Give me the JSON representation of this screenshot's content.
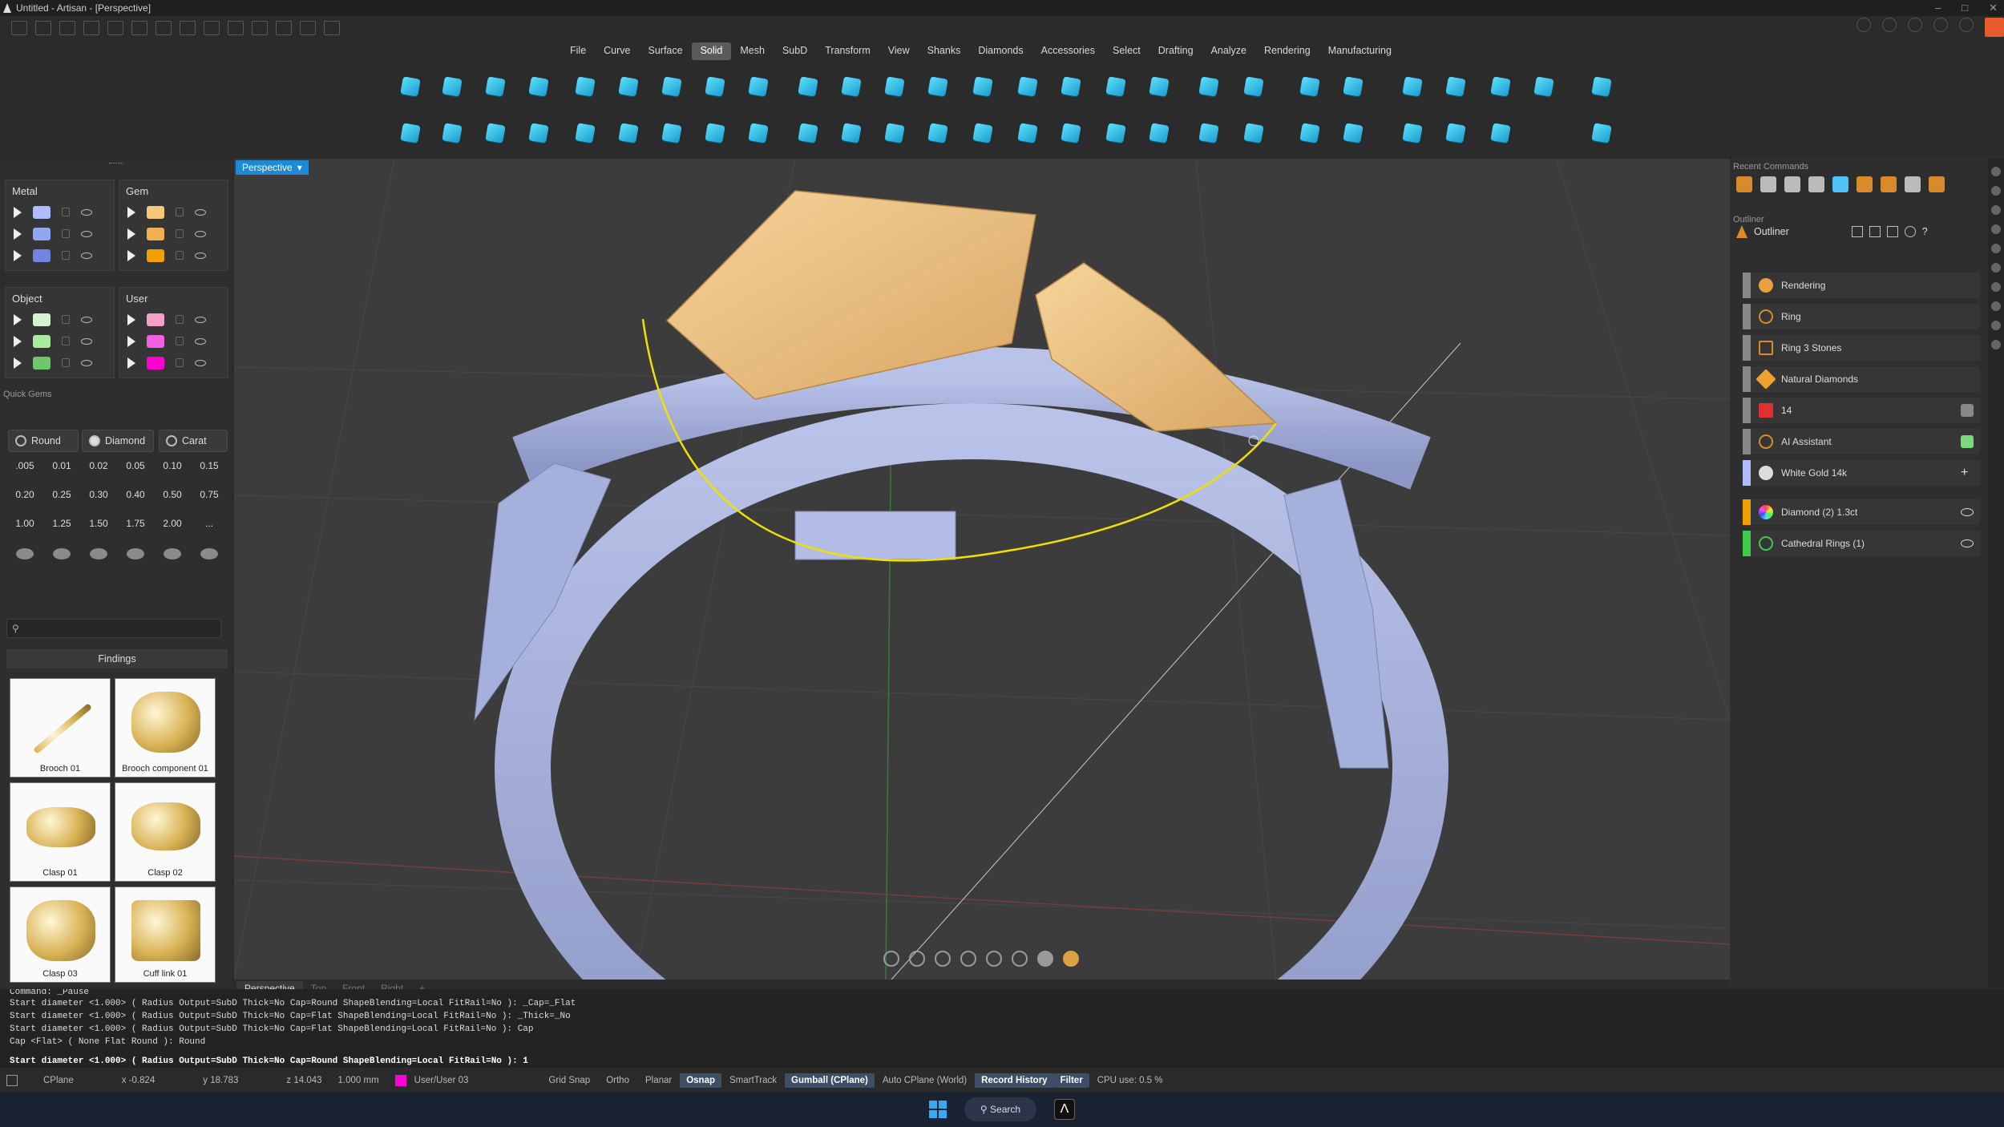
{
  "window": {
    "title": "Untitled - Artisan - [Perspective]"
  },
  "menus": [
    "File",
    "Curve",
    "Surface",
    "Solid",
    "Mesh",
    "SubD",
    "Transform",
    "View",
    "Shanks",
    "Diamonds",
    "Accessories",
    "Select",
    "Drafting",
    "Analyze",
    "Rendering",
    "Manufacturing"
  ],
  "menu_active": "Solid",
  "layers": {
    "metal": {
      "title": "Metal",
      "colors": [
        "#aebcff",
        "#8ea8f0",
        "#6f86e0"
      ]
    },
    "gem": {
      "title": "Gem",
      "colors": [
        "#f5c87a",
        "#f0b04e",
        "#f0a000"
      ]
    },
    "object": {
      "title": "Object",
      "colors": [
        "#d4f5d0",
        "#a8ec9e",
        "#6ec86a"
      ]
    },
    "user": {
      "title": "User",
      "colors": [
        "#f5a0c8",
        "#f060e0",
        "#ff00d0"
      ]
    }
  },
  "quick_gems": {
    "label": "Quick Gems",
    "tabs": [
      "Round",
      "Diamond",
      "Carat"
    ],
    "sizes": [
      ".005",
      "0.01",
      "0.02",
      "0.05",
      "0.10",
      "0.15",
      "0.20",
      "0.25",
      "0.30",
      "0.40",
      "0.50",
      "0.75",
      "1.00",
      "1.25",
      "1.50",
      "1.75",
      "2.00",
      "..."
    ]
  },
  "library": {
    "search_placeholder": "",
    "group": "Findings",
    "items": [
      "Brooch 01",
      "Brooch component 01",
      "Clasp 01",
      "Clasp 02",
      "Clasp 03",
      "Cuff link 01"
    ]
  },
  "viewport": {
    "active_tab": "Perspective",
    "tabs": [
      "Perspective",
      "Top",
      "Front",
      "Right"
    ],
    "add_tab": "+"
  },
  "recent_commands": {
    "label": "Recent Commands"
  },
  "outliner": {
    "label": "Outliner",
    "title": "Outliner",
    "rows": [
      {
        "label": "Rendering",
        "color": "#888888",
        "icon_color": "#e8a040"
      },
      {
        "label": "Ring",
        "color": "#888888",
        "icon_color": "#d98a2b"
      },
      {
        "label": "Ring 3 Stones",
        "color": "#888888",
        "icon_color": "#d98a2b"
      },
      {
        "label": "Natural Diamonds",
        "color": "#888888",
        "icon_color": "#f0a030"
      },
      {
        "label": "14",
        "color": "#888888",
        "icon_color": "#e03030"
      },
      {
        "label": "AI Assistant",
        "color": "#888888",
        "icon_color": "#d98a2b"
      },
      {
        "label": "White Gold 14k",
        "color": "#aebcff",
        "icon_color": "#dddddd"
      },
      {
        "label": "Diamond (2) 1.3ct",
        "color": "#f0a000",
        "icon_color": "#f0f0f0"
      },
      {
        "label": "Cathedral Rings (1)",
        "color": "#3ccc4c",
        "icon_color": "#3ccc4c"
      }
    ]
  },
  "command": {
    "lines": [
      "Command: _Pause",
      "Start diameter <1.000> ( Radius  Output=SubD  Thick=No  Cap=Round  ShapeBlending=Local  FitRail=No ): _Cap=_Flat",
      "Start diameter <1.000> ( Radius  Output=SubD  Thick=No  Cap=Flat  ShapeBlending=Local  FitRail=No ): _Thick=_No",
      "Start diameter <1.000> ( Radius  Output=SubD  Thick=No  Cap=Flat  ShapeBlending=Local  FitRail=No ): Cap",
      "Cap <Flat> ( None  Flat  Round ): Round"
    ],
    "current": "Start diameter <1.000> ( Radius  Output=SubD  Thick=No  Cap=Round  ShapeBlending=Local  FitRail=No ): 1"
  },
  "status": {
    "cplane": "CPlane",
    "x": "x -0.824",
    "y": "y 18.783",
    "z": "z 14.043",
    "units": "1.000 mm",
    "layer": "User/User 03",
    "toggles": [
      "Grid Snap",
      "Ortho",
      "Planar",
      "Osnap",
      "SmartTrack",
      "Gumball (CPlane)",
      "Auto CPlane (World)",
      "Record History",
      "Filter"
    ],
    "active_toggles": [
      "Osnap",
      "Gumball (CPlane)",
      "Record History",
      "Filter"
    ],
    "cpu": "CPU use: 0.5 %"
  },
  "taskbar": {
    "search": "Search"
  }
}
